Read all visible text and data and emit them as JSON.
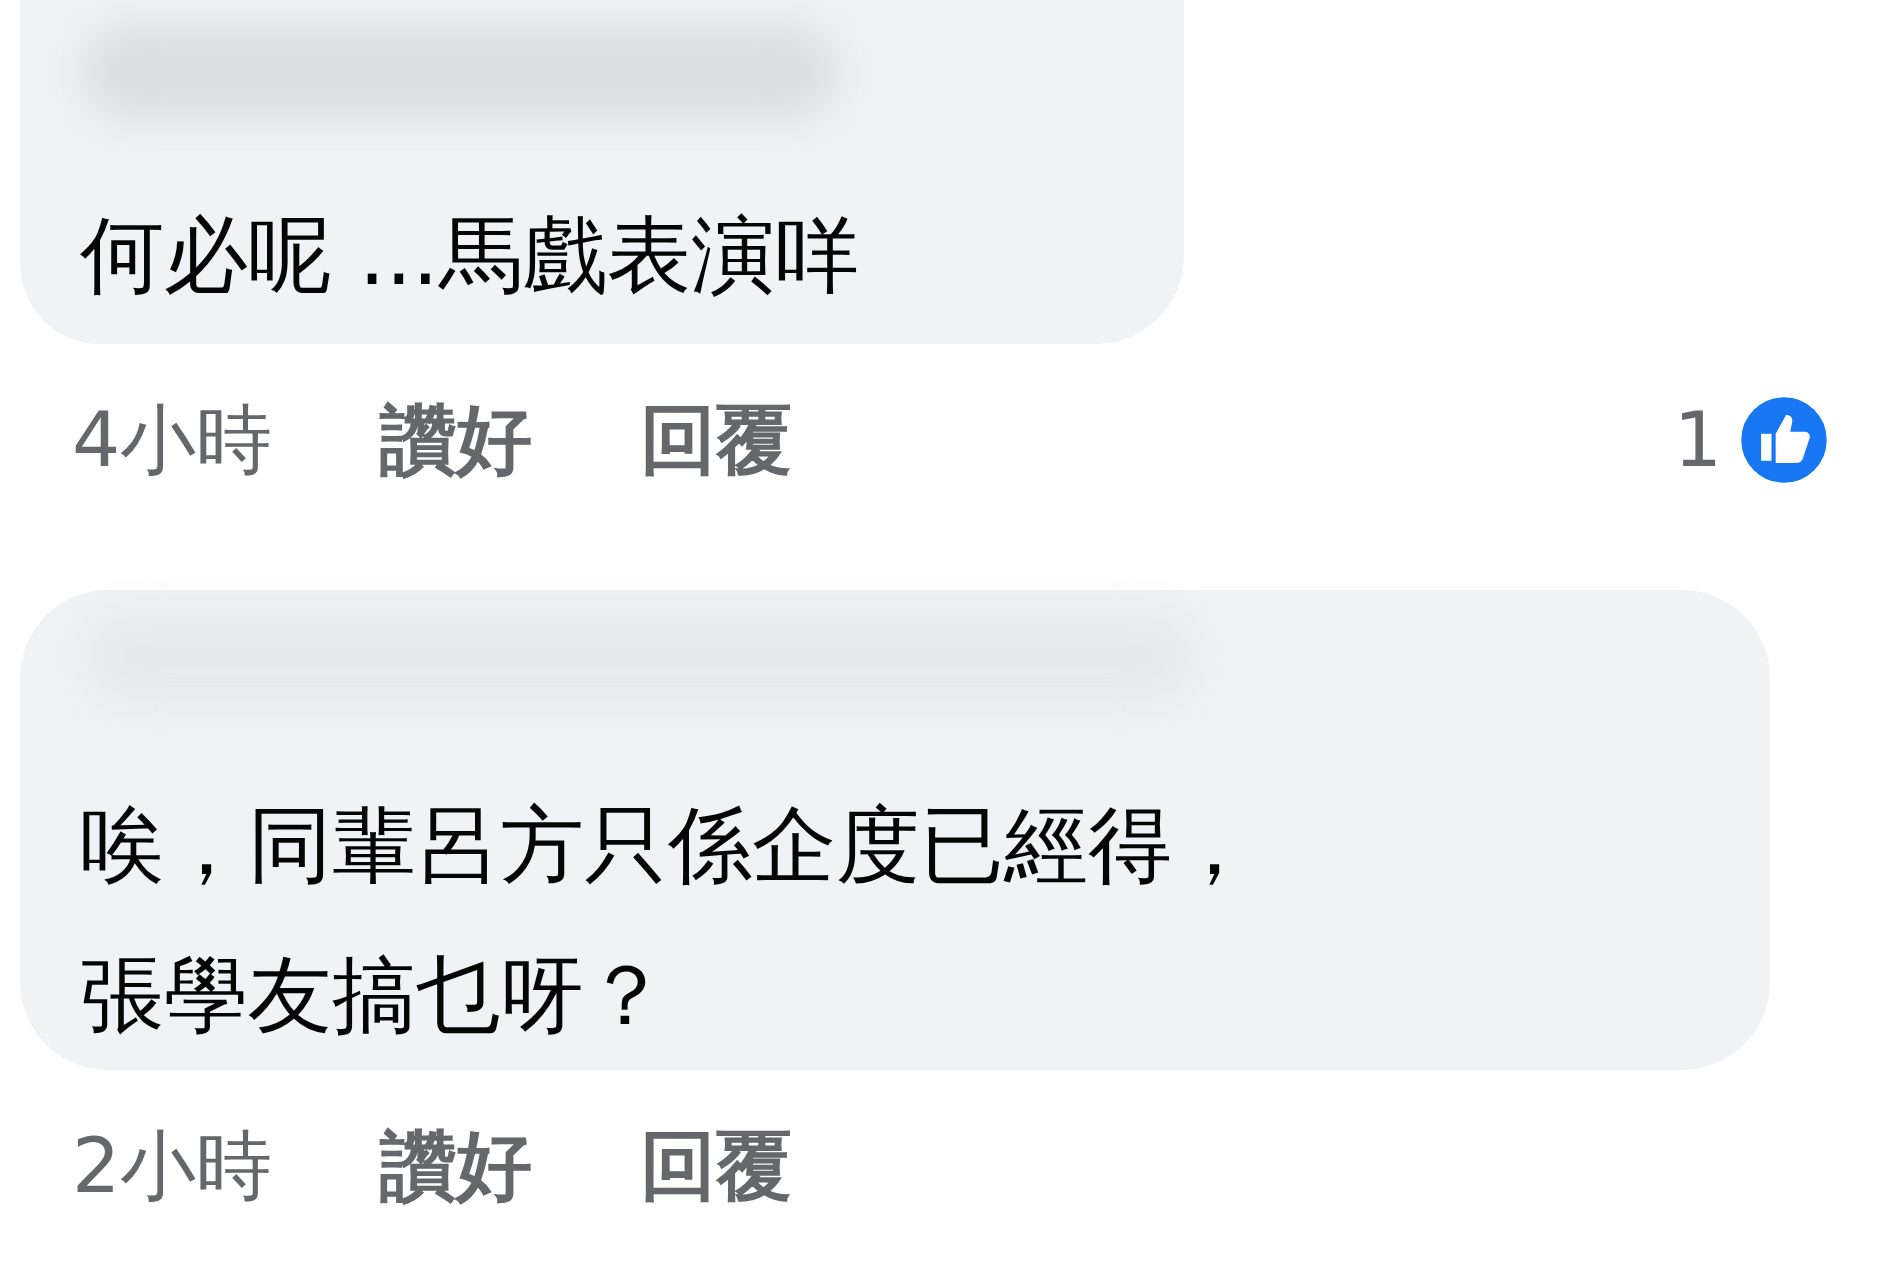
{
  "comments": [
    {
      "name_hidden": true,
      "lines": [
        "何必呢 ...馬戲表演咩"
      ],
      "time": "4小時",
      "actions": [
        "讚好",
        "回覆"
      ],
      "like_count": "1"
    },
    {
      "name_hidden": true,
      "lines": [
        "唉，同輩呂方只係企度已經得，",
        "張學友搞乜呀？"
      ],
      "time": "2小時",
      "actions": [
        "讚好",
        "回覆"
      ]
    }
  ]
}
